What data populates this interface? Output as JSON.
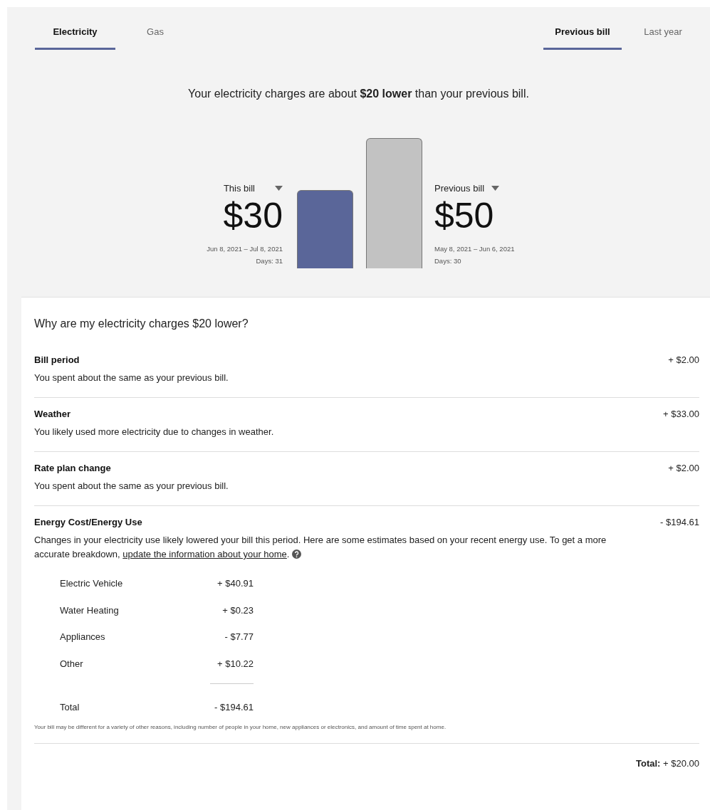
{
  "fuel_tabs": [
    {
      "label": "Electricity",
      "selected": true
    },
    {
      "label": "Gas",
      "selected": false
    }
  ],
  "compare_tabs": [
    {
      "label": "Previous bill",
      "selected": true
    },
    {
      "label": "Last year",
      "selected": false
    }
  ],
  "headline": "Your electricity charges are about **$20 lower** than your previous bill.",
  "bills": [
    {
      "label": "This bill",
      "amount": "$30",
      "period": "Jun 8, 2021 – Jul 8, 2021",
      "days": "Days: 31",
      "kind": "current",
      "color": "#5a6699"
    },
    {
      "label": "Previous bill",
      "amount": "$50",
      "period": "May 8, 2021 – Jun 6, 2021",
      "days": "Days: 30",
      "kind": "previous",
      "color": "#c2c2c2"
    }
  ],
  "breakdown": {
    "title": "Why are my electricity charges $20 lower?",
    "factors": [
      {
        "name": "Bill period",
        "amount": "+ $2.00",
        "description": "You spent about the same as your previous bill."
      },
      {
        "name": "Weather",
        "amount": "+ $33.00",
        "description": "You likely used more electricity due to changes in weather."
      },
      {
        "name": "Rate plan change",
        "amount": "+ $2.00",
        "description": "You spent about the same as your previous bill."
      },
      {
        "name": "Energy Cost/Energy Use",
        "amount": "- $194.61",
        "description": "Changes in your electricity use likely lowered your bill this period. Here are some estimates based on your recent energy use. To get a more accurate breakdown,",
        "link": "update the information about your home",
        "after_link": ".",
        "items": [
          {
            "label": "Electric Vehicle",
            "amount": "+ $40.91"
          },
          {
            "label": "Water Heating",
            "amount": "+ $0.23"
          },
          {
            "label": "Appliances",
            "amount": "- $7.77"
          },
          {
            "label": "Other",
            "amount": "+ $10.22"
          }
        ],
        "total": {
          "label": "Total",
          "amount": "- $194.61"
        }
      }
    ],
    "footnote": "Your bill may be different for a variety of other reasons, including number of people in your home, new appliances or electronics, and amount of time spent at home.",
    "total": "**Total:** + $20.00"
  }
}
